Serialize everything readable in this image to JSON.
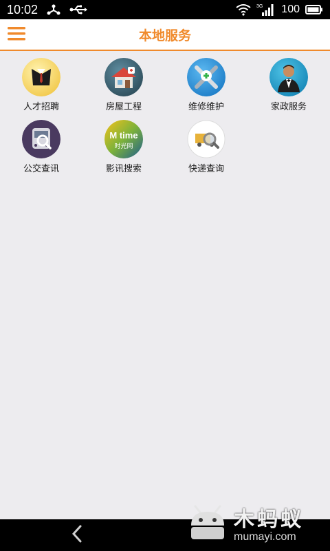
{
  "status_bar": {
    "time": "10:02",
    "battery": "100",
    "icons": [
      "network-share-icon",
      "usb-icon",
      "wifi-icon",
      "signal-icon",
      "battery-icon"
    ],
    "network_type": "3G"
  },
  "app_bar": {
    "title": "本地服务",
    "menu_icon": "hamburger-menu-icon"
  },
  "services": [
    {
      "label": "人才招聘",
      "icon": "suit-icon"
    },
    {
      "label": "房屋工程",
      "icon": "house-icon"
    },
    {
      "label": "维修维护",
      "icon": "repair-tools-icon"
    },
    {
      "label": "家政服务",
      "icon": "butler-icon"
    },
    {
      "label": "公交查讯",
      "icon": "bus-search-icon"
    },
    {
      "label": "影讯搜索",
      "icon": "mtime-logo-icon"
    },
    {
      "label": "快递查询",
      "icon": "delivery-search-icon"
    }
  ],
  "mtime_logo": {
    "top": "M time",
    "bottom": "时光网"
  },
  "watermark": {
    "cn": "木蚂蚁",
    "url": "mumayi.com"
  },
  "colors": {
    "accent": "#F08A2C",
    "background": "#EDECEF"
  }
}
